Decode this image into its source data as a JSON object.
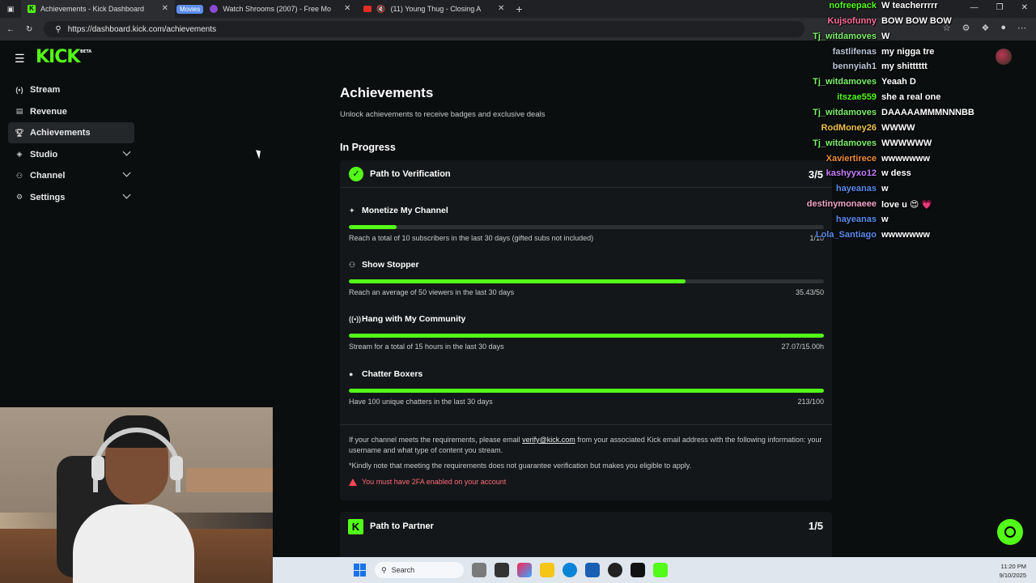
{
  "browser": {
    "tabs": [
      {
        "title": "Achievements - Kick Dashboard"
      },
      {
        "group": "Movies",
        "title": "Watch Shrooms (2007) - Free Mo"
      },
      {
        "title": "(11) Young Thug - Closing A"
      }
    ],
    "url": "https://dashboard.kick.com/achievements"
  },
  "brand": {
    "logo": "KICK",
    "beta": "BETA",
    "accent": "#53fc18"
  },
  "sidebar": {
    "items": [
      {
        "label": "Stream",
        "icon": "stream-icon"
      },
      {
        "label": "Revenue",
        "icon": "revenue-icon"
      },
      {
        "label": "Achievements",
        "icon": "trophy-icon",
        "active": true
      },
      {
        "label": "Studio",
        "icon": "studio-icon",
        "expandable": true
      },
      {
        "label": "Channel",
        "icon": "channel-icon",
        "expandable": true
      },
      {
        "label": "Settings",
        "icon": "gear-icon",
        "expandable": true
      }
    ]
  },
  "main": {
    "title": "Achievements",
    "subtitle": "Unlock achievements to receive badges and exclusive deals",
    "section": "In Progress",
    "verification": {
      "title": "Path to Verification",
      "count": "3/5",
      "achievements": [
        {
          "title": "Monetize My Channel",
          "desc": "Reach a total of 10 subscribers in the last 30 days (gifted subs not included)",
          "progress_text": "1/10",
          "progress": 0.1
        },
        {
          "title": "Show Stopper",
          "desc": "Reach an average of 50 viewers in the last 30 days",
          "progress_text": "35.43/50",
          "progress": 0.7086
        },
        {
          "title": "Hang with My Community",
          "desc": "Stream for a total of 15 hours in the last 30 days",
          "progress_text": "27.07/15.00h",
          "progress": 1.0
        },
        {
          "title": "Chatter Boxers",
          "desc": "Have 100 unique chatters in the last 30 days",
          "progress_text": "213/100",
          "progress": 1.0
        }
      ],
      "info_before": "If your channel meets the requirements, please email ",
      "info_email": "verify@kick.com",
      "info_after": " from your associated Kick email address with the following information: your username and what type of content you stream.",
      "note": "*Kindly note that meeting the requirements does not guarantee verification but makes you eligible to apply.",
      "warning": "You must have 2FA enabled on your account"
    },
    "partner": {
      "title": "Path to Partner",
      "count": "1/5"
    }
  },
  "chat": [
    {
      "user": "nofreepack",
      "color": "#53fc18",
      "msg": "W teacherrrrr"
    },
    {
      "user": "Kujsofunny",
      "color": "#ff6b9a",
      "msg": "BOW BOW BOW"
    },
    {
      "user": "Tj_witdamoves",
      "color": "#7cf26a",
      "msg": "W"
    },
    {
      "user": "fastlifenas",
      "color": "#b9c6d6",
      "msg": "my nigga tre"
    },
    {
      "user": "bennyiah1",
      "color": "#b9c6d6",
      "msg": "my shitttttt"
    },
    {
      "user": "Tj_witdamoves",
      "color": "#7cf26a",
      "msg": "Yeaah D"
    },
    {
      "user": "itszae559",
      "color": "#53fc18",
      "msg": "she a real one"
    },
    {
      "user": "Tj_witdamoves",
      "color": "#7cf26a",
      "msg": "DAAAAAMMMNNNBB"
    },
    {
      "user": "RodMoney26",
      "color": "#f0c24b",
      "msg": "WWWW"
    },
    {
      "user": "Tj_witdamoves",
      "color": "#7cf26a",
      "msg": "WWWWWW"
    },
    {
      "user": "Xaviertirece",
      "color": "#f08c3a",
      "msg": "wwwwwww"
    },
    {
      "user": "kashyyxo12",
      "color": "#c77dff",
      "msg": "w dess"
    },
    {
      "user": "hayeanas",
      "color": "#5b8def",
      "msg": "w"
    },
    {
      "user": "destinymonaeee",
      "color": "#f2a6c8",
      "msg": "love u 😍 💗"
    },
    {
      "user": "hayeanas",
      "color": "#5b8def",
      "msg": "w"
    },
    {
      "user": "Lola_Santiago",
      "color": "#5b8def",
      "msg": "wwwwwww"
    }
  ],
  "taskbar": {
    "search_placeholder": "Search",
    "time": "11:20 PM",
    "date": "9/10/2025"
  }
}
